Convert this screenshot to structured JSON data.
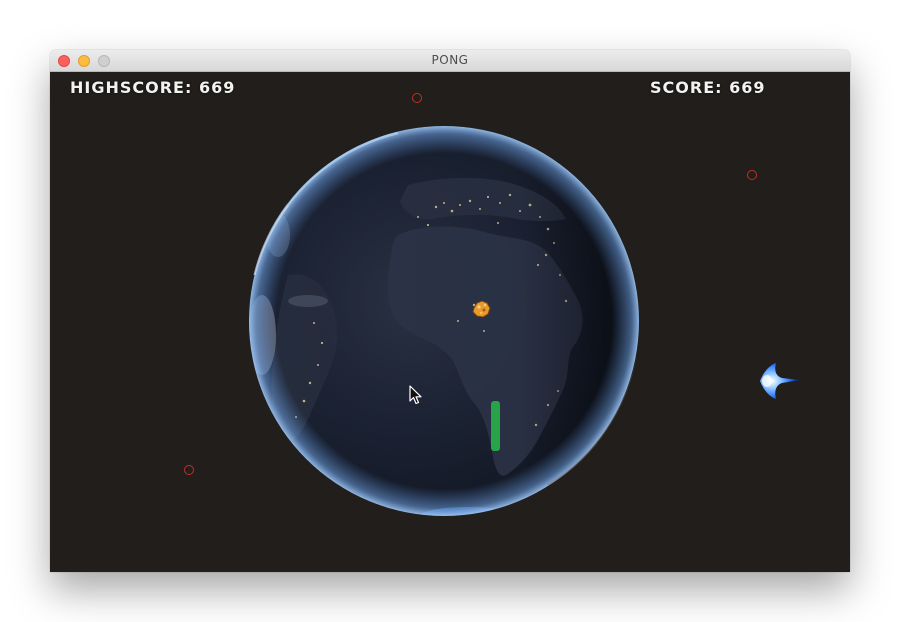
{
  "window": {
    "title": "PONG"
  },
  "hud": {
    "highscore_text": "HIGHSCORE: 669",
    "score_text": "SCORE: 669"
  },
  "sprites": {
    "planet": "earth-night",
    "ball": "rock-ball",
    "paddle": "paddle",
    "enemy": "blue-starship",
    "targets": [
      "red-ring",
      "red-ring",
      "red-ring"
    ]
  },
  "colors": {
    "background": "#211e1b",
    "hud_text": "#f2f2f2",
    "paddle": "#27a448",
    "target_ring": "#c2301f",
    "ship": "#2f7dff"
  }
}
